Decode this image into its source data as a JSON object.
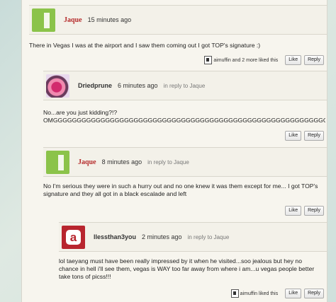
{
  "comments": [
    {
      "author": "Jaque",
      "time": "15 minutes ago",
      "reply_to": "",
      "body": "There in Vegas I was at the airport and I saw them coming out I got TOP's signature :)",
      "liked_by": "aimuffin and 2 more liked this",
      "like_label": "Like",
      "reply_label": "Reply"
    },
    {
      "author": "Driedprune",
      "time": "6 minutes ago",
      "reply_to": "in reply to Jaque",
      "body": "No...are you just kidding?!?\nOMGGGGGGGGGGGGGGGGGGGGGGGGGGGGGGGGGGGGGGGGGGGGGGGGGGGGGGGGGGG",
      "like_label": "Like",
      "reply_label": "Reply"
    },
    {
      "author": "Jaque",
      "time": "8 minutes ago",
      "reply_to": "in reply to Jaque",
      "body": "No I'm serious they were in such a hurry out and no one knew it was them except for me... I got TOP's signature and they all got in a black escalade and left",
      "like_label": "Like",
      "reply_label": "Reply"
    },
    {
      "author": "llessthan3you",
      "time": "2 minutes ago",
      "reply_to": "in reply to Jaque",
      "body": "lol taeyang must have been really impressed by it when he visited...soo jealous but hey no chance in hell i'll see them, vegas is WAY too far away from where i am...u vegas people better take tons of picss!!!",
      "liked_by": "aimuffin liked this",
      "like_label": "Like",
      "reply_label": "Reply"
    }
  ],
  "icons": {
    "c0_avatar": "green-exclamation-avatar",
    "c1_avatar": "flower-avatar",
    "c2_avatar": "green-exclamation-avatar",
    "c3_avatar": "red-a-avatar"
  }
}
